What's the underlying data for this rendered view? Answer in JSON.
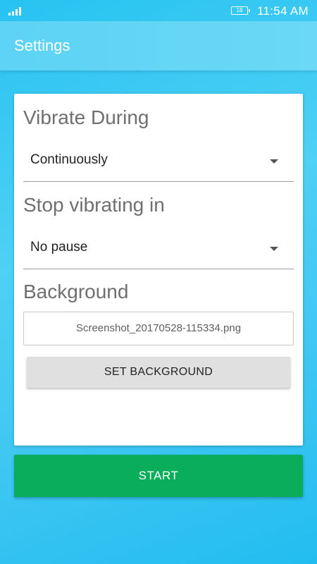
{
  "status_bar": {
    "battery_level": "18",
    "time": "11:54 AM",
    "icons": [
      "signal-icon",
      "battery-icon"
    ]
  },
  "app_bar": {
    "title": "Settings"
  },
  "settings": {
    "vibrate_during": {
      "title": "Vibrate During",
      "selected": "Continuously"
    },
    "stop_vibrating": {
      "title": "Stop vibrating in",
      "selected": "No pause"
    },
    "background": {
      "title": "Background",
      "filename": "Screenshot_20170528-115334.png",
      "button_label": "SET BACKGROUND"
    }
  },
  "start_label": "START",
  "colors": {
    "background": "#33c4f2",
    "app_bar": "#62d5f5",
    "start_button": "#0aae5a",
    "secondary_button": "#e0e0e0"
  }
}
